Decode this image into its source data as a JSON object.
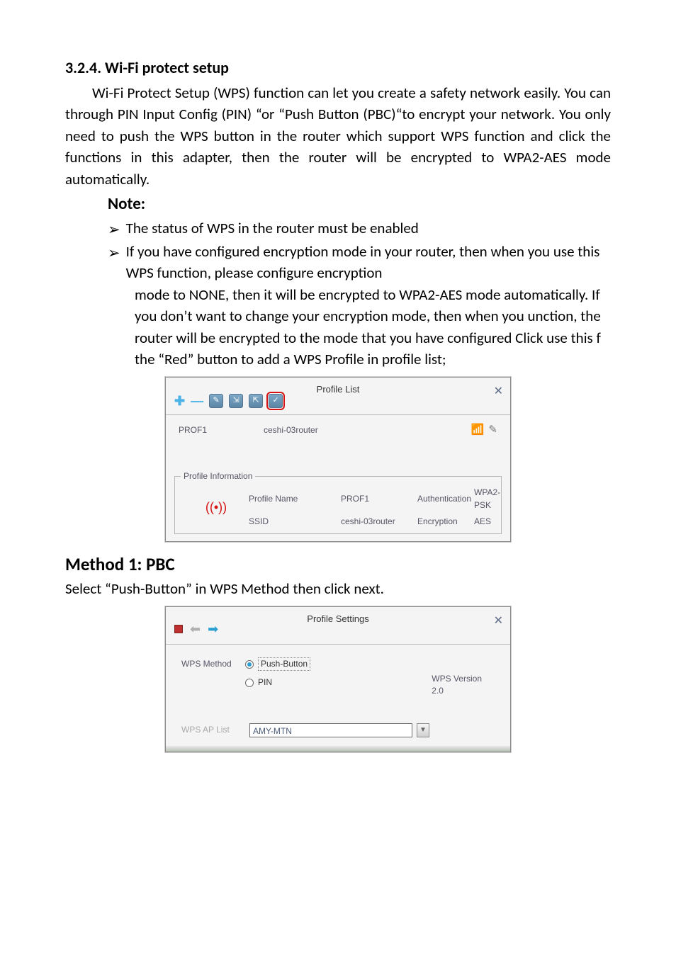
{
  "doc": {
    "section_heading": "3.2.4. Wi-Fi protect setup",
    "para": "Wi-Fi Protect Setup (WPS) function can let you create a safety network easily. You can through PIN Input Config (PIN) “or “Push Button (PBC)“to encrypt your network. You  only  need   to   push   the   WPS   button   in  the   router   which   support   WPS function  and  click  the functions  in  this  adapter,  then  the  router  will  be  encrypted  to  WPA2-AES  mode automatically.",
    "note_label": "Note:",
    "bullet1": "The status of WPS in the router must be enabled",
    "bullet2a": "If you have configured encryption mode in your router, then when you use this WPS function,    please    configure    encryption",
    "bullet2b": "mode    to    NONE,    then    it    will be    encrypted    to WPA2-AES mode automatically. If you don’t want to change your encryption mode, then when you unction, the    router    will be    encrypted to the    mode    that you have configured Click use    this    f the “Red” button to add a WPS Profile in profile list;",
    "method_heading": "Method 1: PBC",
    "method_sub": "Select “Push-Button” in WPS Method then click next."
  },
  "dlg1": {
    "title": "Profile List",
    "close": "✕",
    "profile_name": "PROF1",
    "profile_ssid": "ceshi-03router",
    "legend": "Profile Information",
    "rows": {
      "pn_lbl": "Profile Name",
      "pn_val": "PROF1",
      "auth_lbl": "Authentication",
      "auth_val": "WPA2-PSK",
      "ssid_lbl": "SSID",
      "ssid_val": "ceshi-03router",
      "enc_lbl": "Encryption",
      "enc_val": "AES"
    }
  },
  "dlg2": {
    "title": "Profile Settings",
    "close": "✕",
    "wps_method_lbl": "WPS Method",
    "opt_push": "Push-Button",
    "opt_pin": "PIN",
    "ver_lbl": "WPS Version",
    "ver_val": "2.0",
    "ap_lbl": "WPS AP List",
    "ap_val": "AMY-MTN"
  }
}
